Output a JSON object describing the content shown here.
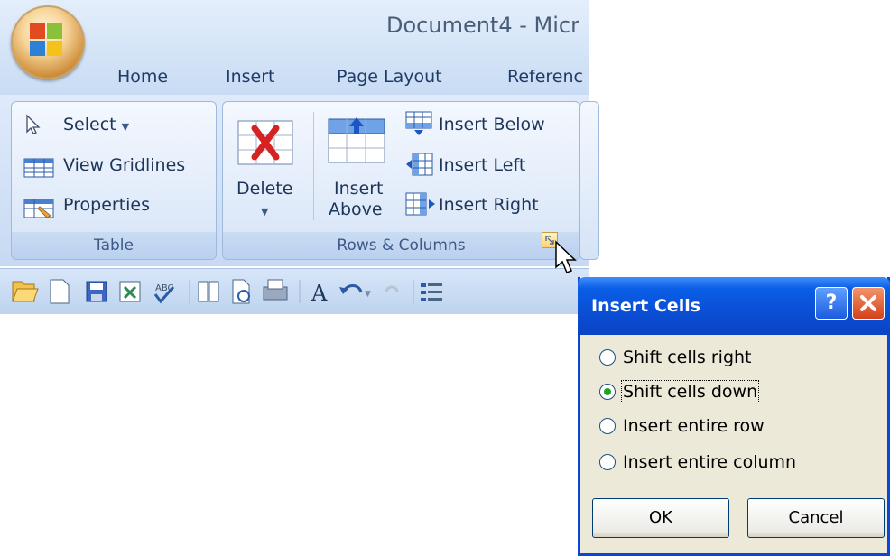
{
  "window": {
    "title": "Document4 - Micr"
  },
  "tabs": [
    {
      "label": "Home"
    },
    {
      "label": "Insert"
    },
    {
      "label": "Page Layout"
    },
    {
      "label": "Referenc"
    }
  ],
  "ribbon": {
    "table_group": {
      "caption": "Table",
      "select_label": "Select",
      "view_gridlines_label": "View Gridlines",
      "properties_label": "Properties"
    },
    "rows_columns_group": {
      "caption": "Rows & Columns",
      "delete_label": "Delete",
      "insert_above_line1": "Insert",
      "insert_above_line2": "Above",
      "insert_below_label": "Insert Below",
      "insert_left_label": "Insert Left",
      "insert_right_label": "Insert Right"
    }
  },
  "quick_access_toolbar": {
    "icons": [
      "open-icon",
      "new-icon",
      "save-icon",
      "permission-icon",
      "spelling-icon",
      "research-icon",
      "print-preview-icon",
      "print-icon",
      "font-icon",
      "undo-icon",
      "redo-icon",
      "bullets-icon"
    ]
  },
  "dialog": {
    "title": "Insert Cells",
    "help_button": "?",
    "options": [
      {
        "label": "Shift cells right",
        "selected": false
      },
      {
        "label": "Shift cells down",
        "selected": true
      },
      {
        "label": "Insert entire row",
        "selected": false
      },
      {
        "label": "Insert entire column",
        "selected": false
      }
    ],
    "ok_label": "OK",
    "cancel_label": "Cancel"
  },
  "colors": {
    "dialog_title": "#0a4fd5",
    "ribbon_bg": "#dfeafb",
    "radio_selected": "#21a121"
  }
}
